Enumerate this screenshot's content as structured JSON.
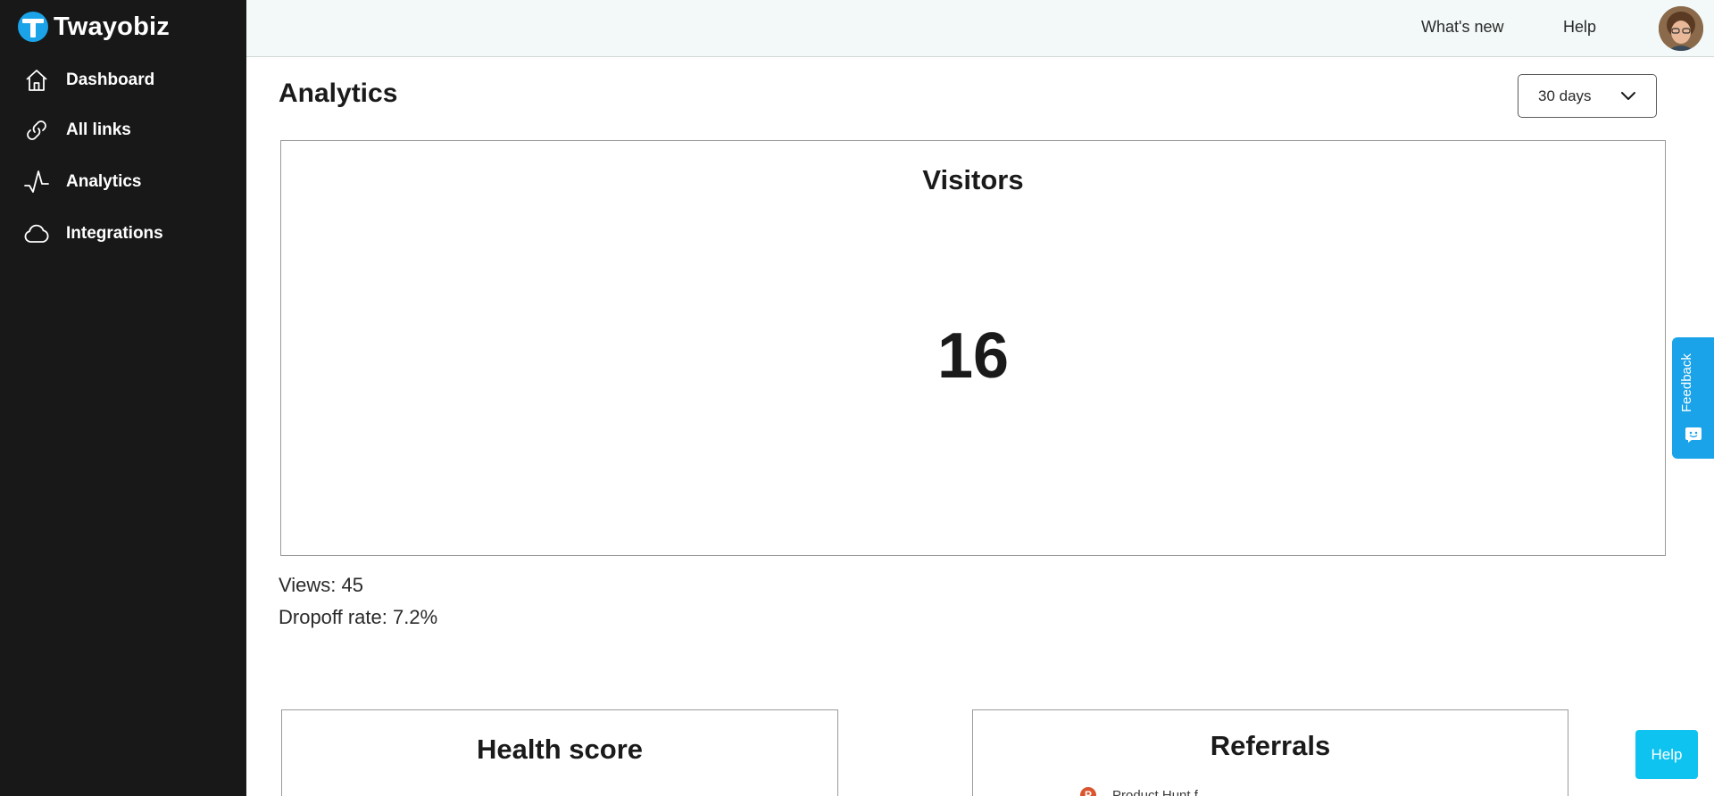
{
  "brand": {
    "name": "Twayobiz",
    "accent": "#1aa3e8"
  },
  "sidebar": {
    "items": [
      {
        "label": "Dashboard",
        "icon": "home-icon"
      },
      {
        "label": "All links",
        "icon": "link-icon"
      },
      {
        "label": "Analytics",
        "icon": "activity-icon"
      },
      {
        "label": "Integrations",
        "icon": "cloud-icon"
      }
    ]
  },
  "topbar": {
    "whats_new": "What's new",
    "help": "Help"
  },
  "main": {
    "title": "Analytics",
    "range": {
      "selected": "30 days"
    },
    "visitors": {
      "title": "Visitors",
      "value": "16"
    },
    "views_text": "Views: 45",
    "dropoff_text": "Dropoff rate: 7.2%",
    "health_card": {
      "title": "Health score"
    },
    "referrals_card": {
      "title": "Referrals",
      "first_item": "Product Hunt f..."
    }
  },
  "feedback_tab": {
    "label": "Feedback",
    "color": "#1aa3e8"
  },
  "help_button": {
    "label": "Help",
    "color": "#0fc3f0"
  }
}
